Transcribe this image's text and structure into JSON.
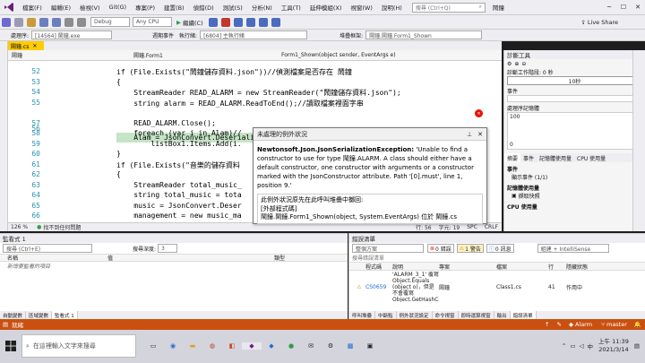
{
  "titlebar": {
    "menus": [
      "檔案(F)",
      "編輯(E)",
      "檢視(V)",
      "Git(G)",
      "專案(P)",
      "建置(B)",
      "偵錯(D)",
      "測試(S)",
      "分析(N)",
      "工具(T)",
      "延伸模組(X)",
      "視窗(W)",
      "說明(H)"
    ],
    "search_placeholder": "搜尋 (Ctrl+Q)",
    "project_name": "鬧鐘",
    "live_share": "Live Share"
  },
  "toolbar": {
    "config": "Debug",
    "platform": "Any CPU",
    "continue": "繼續(C)"
  },
  "toolbar2": {
    "process_label": "處理序:",
    "process_value": "[14564] 鬧鐘.exe",
    "lifecycle_label": "週期事件",
    "thread_label": "執行緒:",
    "thread_value": "[6804] 主執行緒",
    "stack_label": "堆疊框架:",
    "stack_value": "鬧鐘.鬧鐘.Form1_Shown"
  },
  "editor": {
    "tab_label": "鬧鐘.cs",
    "nav_left": "鬧鐘",
    "nav_mid": "鬧鐘.Form1",
    "nav_right": "Form1_Shown(object sender, EventArgs e)",
    "lines": [
      {
        "num": "52",
        "code": "if (File.Exists(\"鬧鐘儲存資料.json\"))//偵測檔案是否存在 鬧鐘"
      },
      {
        "num": "53",
        "code": "{"
      },
      {
        "num": "54",
        "code": "    StreamReader READ_ALARM = new StreamReader(\"鬧鐘儲存資料.json\");"
      },
      {
        "num": "55",
        "code": "    string alarm = READ_ALARM.ReadToEnd();//讀取檔案裡面字串"
      },
      {
        "num": "56",
        "code": "    Alam = JsonConvert.DeserializeObject<List<ALARM>>(alarm);//反序列化 格式List"
      },
      {
        "num": "57",
        "code": "    READ_ALARM.Close();"
      },
      {
        "num": "58",
        "code": "    foreach (var i in Alam)//"
      },
      {
        "num": "59",
        "code": "        listBox1.Items.Add(i."
      },
      {
        "num": "60",
        "code": "}"
      },
      {
        "num": "61",
        "code": "if (File.Exists(\"音樂的儲存資料"
      },
      {
        "num": "62",
        "code": "{"
      },
      {
        "num": "63",
        "code": "    StreamReader total_music_"
      },
      {
        "num": "64",
        "code": "    string total_music = tota"
      },
      {
        "num": "65",
        "code": "    music = JsonConvert.Deser"
      },
      {
        "num": "66",
        "code": "    management = new music_ma"
      }
    ],
    "zoom": "126 %",
    "issues": "找不到任何問題",
    "line_col": "行: 56",
    "char": "字元: 19",
    "spc": "SPC",
    "crlf": "CRLF"
  },
  "popup": {
    "title": "未處理的例外狀況",
    "exception_type": "Newtonsoft.Json.JsonSerializationException:",
    "message": "'Unable to find a constructor to use for type 鬧鐘.ALARM. A class should either have a default constructor, one constructor with arguments or a constructor marked with the JsonConstructor attribute. Path '[0].must', line 1, position 9.'",
    "detail1": "此例外狀況原先在此呼叫堆疊中擲回:",
    "detail2": "[外部程式碼]",
    "detail3": "鬧鐘.鬧鐘.Form1_Shown(object, System.EventArgs) 位於 鬧鐘.cs"
  },
  "diag": {
    "title": "診斷工具",
    "session": "診斷工作階段: 0 秒",
    "time_mark": "10秒",
    "events": "事件",
    "memory": "處理序記憶體",
    "mem_top": "100",
    "mem_bot": "0",
    "tabs": [
      "摘要",
      "事件",
      "記憶體使用量",
      "CPU 使用量"
    ],
    "events_head": "事件",
    "show_events": "顯示事件 (1/1)",
    "mem_usage": "記憶體使用量",
    "snapshot": "擷取快照",
    "cpu_usage": "CPU 使用量"
  },
  "watch": {
    "title": "監看式 1",
    "search_placeholder": "搜尋 (Ctrl+E)",
    "depth_label": "搜尋深度:",
    "depth_value": "3",
    "col_name": "名稱",
    "col_value": "值",
    "col_type": "類型",
    "add_item": "新增要監看的項目",
    "bottom_tabs": [
      "自動變數",
      "區域變數",
      "監看式 1"
    ]
  },
  "errors": {
    "title": "錯誤清單",
    "scope": "整個方案",
    "errors_count": "0 錯誤",
    "warnings_count": "1 警告",
    "messages_count": "0 訊息",
    "build_filter": "組建 + IntelliSense",
    "search_placeholder": "搜尋錯誤清單",
    "cols": [
      "程式碼",
      "說明",
      "專案",
      "檔案",
      "行",
      "隱藏狀態"
    ],
    "row": {
      "code": "CS0659",
      "desc": "'ALARM_3_1' 覆寫 Object.Equals (object o)，但是不會覆寫 Object.GetHashCode()",
      "project": "鬧鐘",
      "file": "Class1.cs",
      "line": "41",
      "state": "作用中"
    },
    "bottom_tabs": [
      "呼叫堆疊",
      "中斷點",
      "例外狀況設定",
      "命令視窗",
      "即時運算視窗",
      "輸出",
      "錯誤清單"
    ]
  },
  "statusbar": {
    "ready": "就緒",
    "branch": "master",
    "repo": "Alarm"
  },
  "taskbar": {
    "search_placeholder": "在這裡輸入文字來搜尋",
    "time": "上午 11:39",
    "date": "2021/3/14",
    "ime": "中"
  },
  "colors": {
    "accent": "#68217a",
    "status_bar": "#ca5010",
    "tab_active": "#ffcc00",
    "highlight_line": "#c6e4c6"
  }
}
